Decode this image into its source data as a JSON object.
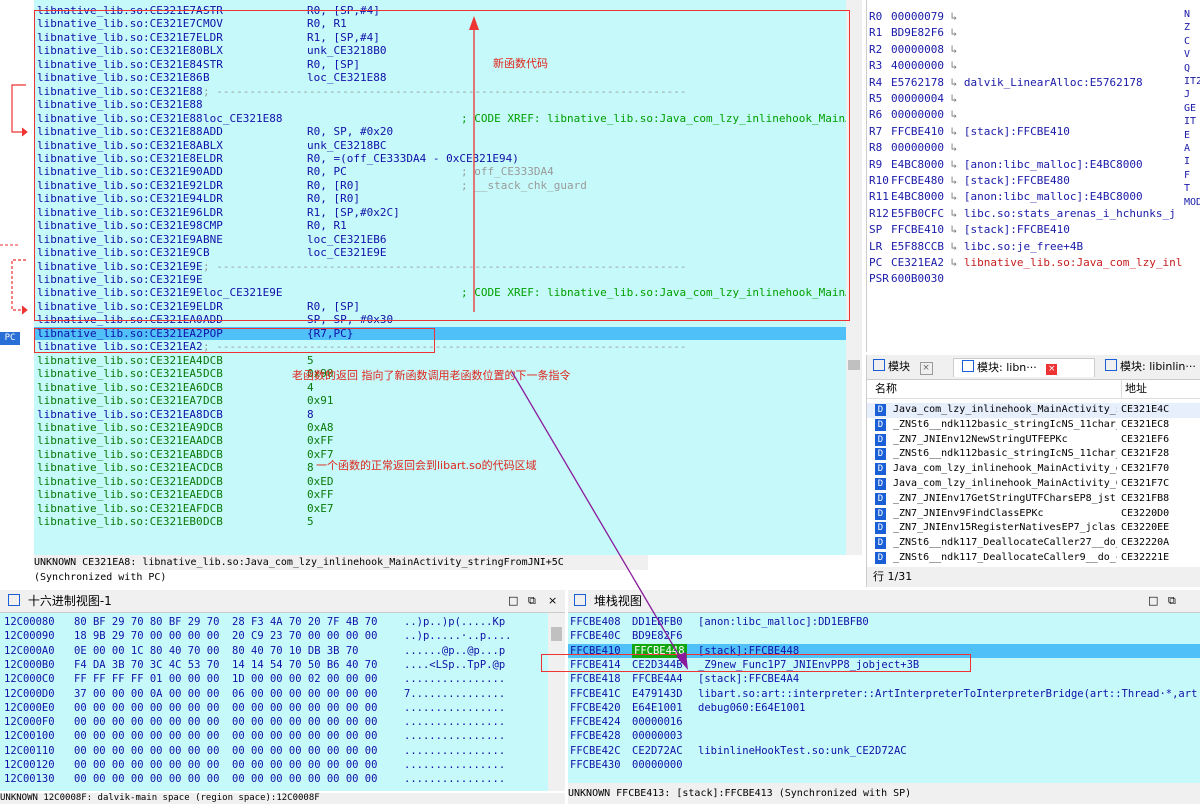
{
  "disasm": {
    "rows": [
      {
        "addr": "libnative_lib.so:CE321E7A",
        "mn": "STR",
        "op": "R0, [SP,#4]",
        "cm": "",
        "style": "code"
      },
      {
        "addr": "libnative_lib.so:CE321E7C",
        "mn": "MOV",
        "op": "R0, R1",
        "cm": "",
        "style": "code"
      },
      {
        "addr": "libnative_lib.so:CE321E7E",
        "mn": "LDR",
        "op": "R1, [SP,#4]",
        "cm": "",
        "style": "code"
      },
      {
        "addr": "libnative_lib.so:CE321E80",
        "mn": "BLX",
        "op": "unk_CE3218B0",
        "cm": "",
        "style": "code"
      },
      {
        "addr": "libnative_lib.so:CE321E84",
        "mn": "STR",
        "op": "R0, [SP]",
        "cm": "",
        "style": "code"
      },
      {
        "addr": "libnative_lib.so:CE321E86",
        "mn": "B",
        "op": "loc_CE321E88",
        "cm": "",
        "style": "code"
      },
      {
        "addr": "libnative_lib.so:CE321E88",
        "mn": "; -----------------------------------------------------------------------",
        "op": "",
        "cm": "",
        "style": "sep"
      },
      {
        "addr": "libnative_lib.so:CE321E88",
        "mn": "",
        "op": "",
        "cm": "",
        "style": "code"
      },
      {
        "addr": "libnative_lib.so:CE321E88",
        "mn": "loc_CE321E88",
        "op": "",
        "cm": "; CODE XREF: libnative_lib.so:Java_com_lzy_inlinehook_MainAc",
        "style": "code"
      },
      {
        "addr": "libnative_lib.so:CE321E88",
        "mn": "ADD",
        "op": "R0, SP, #0x20",
        "cm": "",
        "style": "code"
      },
      {
        "addr": "libnative_lib.so:CE321E8A",
        "mn": "BLX",
        "op": "unk_CE3218BC",
        "cm": "",
        "style": "code"
      },
      {
        "addr": "libnative_lib.so:CE321E8E",
        "mn": "LDR",
        "op": "R0, =(off_CE333DA4 - 0xCE321E94)",
        "cm": "",
        "style": "code"
      },
      {
        "addr": "libnative_lib.so:CE321E90",
        "mn": "ADD",
        "op": "R0, PC",
        "cm": "; off_CE333DA4",
        "style": "code"
      },
      {
        "addr": "libnative_lib.so:CE321E92",
        "mn": "LDR",
        "op": "R0, [R0]",
        "cm": "; __stack_chk_guard",
        "style": "code"
      },
      {
        "addr": "libnative_lib.so:CE321E94",
        "mn": "LDR",
        "op": "R0, [R0]",
        "cm": "",
        "style": "code"
      },
      {
        "addr": "libnative_lib.so:CE321E96",
        "mn": "LDR",
        "op": "R1, [SP,#0x2C]",
        "cm": "",
        "style": "code"
      },
      {
        "addr": "libnative_lib.so:CE321E98",
        "mn": "CMP",
        "op": "R0, R1",
        "cm": "",
        "style": "code"
      },
      {
        "addr": "libnative_lib.so:CE321E9A",
        "mn": "BNE",
        "op": "loc_CE321EB6",
        "cm": "",
        "style": "code"
      },
      {
        "addr": "libnative_lib.so:CE321E9C",
        "mn": "B",
        "op": "loc_CE321E9E",
        "cm": "",
        "style": "code"
      },
      {
        "addr": "libnative_lib.so:CE321E9E",
        "mn": "; -----------------------------------------------------------------------",
        "op": "",
        "cm": "",
        "style": "sep"
      },
      {
        "addr": "libnative_lib.so:CE321E9E",
        "mn": "",
        "op": "",
        "cm": "",
        "style": "code"
      },
      {
        "addr": "libnative_lib.so:CE321E9E",
        "mn": "loc_CE321E9E",
        "op": "",
        "cm": "; CODE XREF: libnative_lib.so:Java_com_lzy_inlinehook_MainAc",
        "style": "code"
      },
      {
        "addr": "libnative_lib.so:CE321E9E",
        "mn": "LDR",
        "op": "R0, [SP]",
        "cm": "",
        "style": "code"
      },
      {
        "addr": "libnative_lib.so:CE321EA0",
        "mn": "ADD",
        "op": "SP, SP, #0x30",
        "cm": "",
        "style": "code"
      },
      {
        "addr": "libnative_lib.so:CE321EA2",
        "mn": "POP",
        "op": "{R7,PC}",
        "cm": "",
        "style": "selected"
      },
      {
        "addr": "libnative_lib.so:CE321EA2",
        "mn": "; -----------------------------------------------------------------------",
        "op": "",
        "cm": "",
        "style": "sep"
      },
      {
        "addr": "libnative_lib.so:CE321EA4",
        "mn": "DCB",
        "op": "5",
        "cm": "",
        "style": "data"
      },
      {
        "addr": "libnative_lib.so:CE321EA5",
        "mn": "DCB",
        "op": "0x90",
        "cm": "",
        "style": "data"
      },
      {
        "addr": "libnative_lib.so:CE321EA6",
        "mn": "DCB",
        "op": "4",
        "cm": "",
        "style": "data"
      },
      {
        "addr": "libnative_lib.so:CE321EA7",
        "mn": "DCB",
        "op": "0x91",
        "cm": "",
        "style": "data"
      },
      {
        "addr": "libnative_lib.so:CE321EA8",
        "mn": "DCB",
        "op": "8",
        "cm": "",
        "style": "code"
      },
      {
        "addr": "libnative_lib.so:CE321EA9",
        "mn": "DCB",
        "op": "0xA8",
        "cm": "",
        "style": "data"
      },
      {
        "addr": "libnative_lib.so:CE321EAA",
        "mn": "DCB",
        "op": "0xFF",
        "cm": "",
        "style": "data"
      },
      {
        "addr": "libnative_lib.so:CE321EAB",
        "mn": "DCB",
        "op": "0xF7",
        "cm": "",
        "style": "data"
      },
      {
        "addr": "libnative_lib.so:CE321EAC",
        "mn": "DCB",
        "op": "8",
        "cm": "",
        "style": "data"
      },
      {
        "addr": "libnative_lib.so:CE321EAD",
        "mn": "DCB",
        "op": "0xED",
        "cm": "",
        "style": "data"
      },
      {
        "addr": "libnative_lib.so:CE321EAE",
        "mn": "DCB",
        "op": "0xFF",
        "cm": "",
        "style": "data"
      },
      {
        "addr": "libnative_lib.so:CE321EAF",
        "mn": "DCB",
        "op": "0xE7",
        "cm": "",
        "style": "data"
      },
      {
        "addr": "libnative_lib.so:CE321EB0",
        "mn": "DCB",
        "op": "5",
        "cm": "",
        "style": "data"
      }
    ],
    "status": "UNKNOWN CE321EA8: libnative_lib.so:Java_com_lzy_inlinehook_MainActivity_stringFromJNI+5C (Synchronized with PC)",
    "pc_marker": "PC",
    "notes": {
      "new_func": "新函数代码",
      "old_return": "老函数的返回  指向了新函数调用老函数位置的下一条指令",
      "normal_return": "一个函数的正常返回会到libart.so的代码区域"
    }
  },
  "registers": [
    {
      "name": "R0",
      "value": "00000079",
      "label": "",
      "red": false
    },
    {
      "name": "R1",
      "value": "BD9E82F6",
      "label": "",
      "red": false
    },
    {
      "name": "R2",
      "value": "00000008",
      "label": "",
      "red": false
    },
    {
      "name": "R3",
      "value": "40000000",
      "label": "",
      "red": false
    },
    {
      "name": "R4",
      "value": "E5762178",
      "label": "dalvik_LinearAlloc:E5762178",
      "red": false
    },
    {
      "name": "R5",
      "value": "00000004",
      "label": "",
      "red": false
    },
    {
      "name": "R6",
      "value": "00000000",
      "label": "",
      "red": false
    },
    {
      "name": "R7",
      "value": "FFCBE410",
      "label": "[stack]:FFCBE410",
      "red": false
    },
    {
      "name": "R8",
      "value": "00000000",
      "label": "",
      "red": false
    },
    {
      "name": "R9",
      "value": "E4BC8000",
      "label": "[anon:libc_malloc]:E4BC8000",
      "red": false
    },
    {
      "name": "R10",
      "value": "FFCBE480",
      "label": "[stack]:FFCBE480",
      "red": false
    },
    {
      "name": "R11",
      "value": "E4BC8000",
      "label": "[anon:libc_malloc]:E4BC8000",
      "red": false
    },
    {
      "name": "R12",
      "value": "E5FB0CFC",
      "label": "libc.so:stats_arenas_i_hchunks_j",
      "red": false
    },
    {
      "name": "SP",
      "value": "FFCBE410",
      "label": "[stack]:FFCBE410",
      "red": false
    },
    {
      "name": "LR",
      "value": "E5F88CCB",
      "label": "libc.so:je_free+4B",
      "red": false
    },
    {
      "name": "PC",
      "value": "CE321EA2",
      "label": "libnative_lib.so:Java_com_lzy_inli",
      "red": true
    },
    {
      "name": "PSR",
      "value": "600B0030",
      "label": "",
      "red": false
    }
  ],
  "flags": [
    "N",
    "Z",
    "C",
    "V",
    "Q",
    "IT2",
    "J",
    "GE",
    "IT",
    "E",
    "A",
    "I",
    "F",
    "T",
    "MOD"
  ],
  "modules": {
    "tabs": [
      "模块",
      "模块: libn···",
      "模块: libinlin···"
    ],
    "col_name": "名称",
    "col_addr": "地址",
    "rows": [
      {
        "name": "Java_com_lzy_inlinehook_MainActivity_s···",
        "addr": "CE321E4C"
      },
      {
        "name": "_ZNSt6__ndk112basic_stringIcNS_11char_···",
        "addr": "CE321EC8"
      },
      {
        "name": "_ZN7_JNIEnv12NewStringUTFEPKc",
        "addr": "CE321EF6"
      },
      {
        "name": "_ZNSt6__ndk112basic_stringIcNS_11char_···",
        "addr": "CE321F28"
      },
      {
        "name": "Java_com_lzy_inlinehook_MainActivity_g···",
        "addr": "CE321F70"
      },
      {
        "name": "Java_com_lzy_inlinehook_MainActivity_C···",
        "addr": "CE321F7C"
      },
      {
        "name": "_ZN7_JNIEnv17GetStringUTFCharsEP8_jstr···",
        "addr": "CE321FB8"
      },
      {
        "name": "_ZN7_JNIEnv9FindClassEPKc",
        "addr": "CE3220D0"
      },
      {
        "name": "_ZN7_JNIEnv15RegisterNativesEP7_jclass···",
        "addr": "CE3220EE"
      },
      {
        "name": "_ZNSt6__ndk117_DeallocateCaller27__do_···",
        "addr": "CE32220A"
      },
      {
        "name": "_ZNSt6__ndk117_DeallocateCaller9__do_c···",
        "addr": "CE32221E"
      }
    ],
    "status": "行 1/31"
  },
  "hex": {
    "title": "十六进制视图-1",
    "rows": [
      {
        "a": "12C00080",
        "b": "80 BF 29 70 80 BF 29 70  28 F3 4A 70 20 7F 4B 70",
        "s": "..)p..)p(.....Kp"
      },
      {
        "a": "12C00090",
        "b": "18 9B 29 70 00 00 00 00  20 C9 23 70 00 00 00 00",
        "s": "..)p.....·..p...."
      },
      {
        "a": "12C000A0",
        "b": "0E 00 00 1C 80 40 70 00  80 40 70 10 DB 3B 70",
        "s": "......@p..@p...p"
      },
      {
        "a": "12C000B0",
        "b": "F4 DA 3B 70 3C 4C 53 70  14 14 54 70 50 B6 40 70",
        "s": "....<LSp..TpP.@p"
      },
      {
        "a": "12C000C0",
        "b": "FF FF FF FF 01 00 00 00  1D 00 00 00 02 00 00 00",
        "s": "................"
      },
      {
        "a": "12C000D0",
        "b": "37 00 00 00 0A 00 00 00  06 00 00 00 00 00 00 00",
        "s": "7..............."
      },
      {
        "a": "12C000E0",
        "b": "00 00 00 00 00 00 00 00  00 00 00 00 00 00 00 00",
        "s": "................"
      },
      {
        "a": "12C000F0",
        "b": "00 00 00 00 00 00 00 00  00 00 00 00 00 00 00 00",
        "s": "................"
      },
      {
        "a": "12C00100",
        "b": "00 00 00 00 00 00 00 00  00 00 00 00 00 00 00 00",
        "s": "................"
      },
      {
        "a": "12C00110",
        "b": "00 00 00 00 00 00 00 00  00 00 00 00 00 00 00 00",
        "s": "................"
      },
      {
        "a": "12C00120",
        "b": "00 00 00 00 00 00 00 00  00 00 00 00 00 00 00 00",
        "s": "................"
      },
      {
        "a": "12C00130",
        "b": "00 00 00 00 00 00 00 00  00 00 00 00 00 00 00 00",
        "s": "................"
      }
    ],
    "status": "UNKNOWN 12C0008F: dalvik-main space (region space):12C0008F"
  },
  "stack": {
    "title": "堆栈视图",
    "rows": [
      {
        "a": "FFCBE408",
        "v": "DD1EBFB0",
        "c": "[anon:libc_malloc]:DD1EBFB0"
      },
      {
        "a": "FFCBE40C",
        "v": "BD9E82F6",
        "c": ""
      },
      {
        "a": "FFCBE410",
        "v": "FFCBE448",
        "c": "[stack]:FFCBE448"
      },
      {
        "a": "FFCBE414",
        "v": "CE2D344B",
        "c": "_Z9new_Func1P7_JNIEnvPP8_jobject+3B"
      },
      {
        "a": "FFCBE418",
        "v": "FFCBE4A4",
        "c": "[stack]:FFCBE4A4"
      },
      {
        "a": "FFCBE41C",
        "v": "E479143D",
        "c": "libart.so:art::interpreter::ArtInterpreterToInterpreterBridge(art::Thread·*,art"
      },
      {
        "a": "FFCBE420",
        "v": "E64E1001",
        "c": "debug060:E64E1001"
      },
      {
        "a": "FFCBE424",
        "v": "00000016",
        "c": ""
      },
      {
        "a": "FFCBE428",
        "v": "00000003",
        "c": ""
      },
      {
        "a": "FFCBE42C",
        "v": "CE2D72AC",
        "c": "libinlineHookTest.so:unk_CE2D72AC"
      },
      {
        "a": "FFCBE430",
        "v": "00000000",
        "c": ""
      }
    ],
    "status": "UNKNOWN FFCBE413: [stack]:FFCBE413 (Synchronized with SP)"
  }
}
